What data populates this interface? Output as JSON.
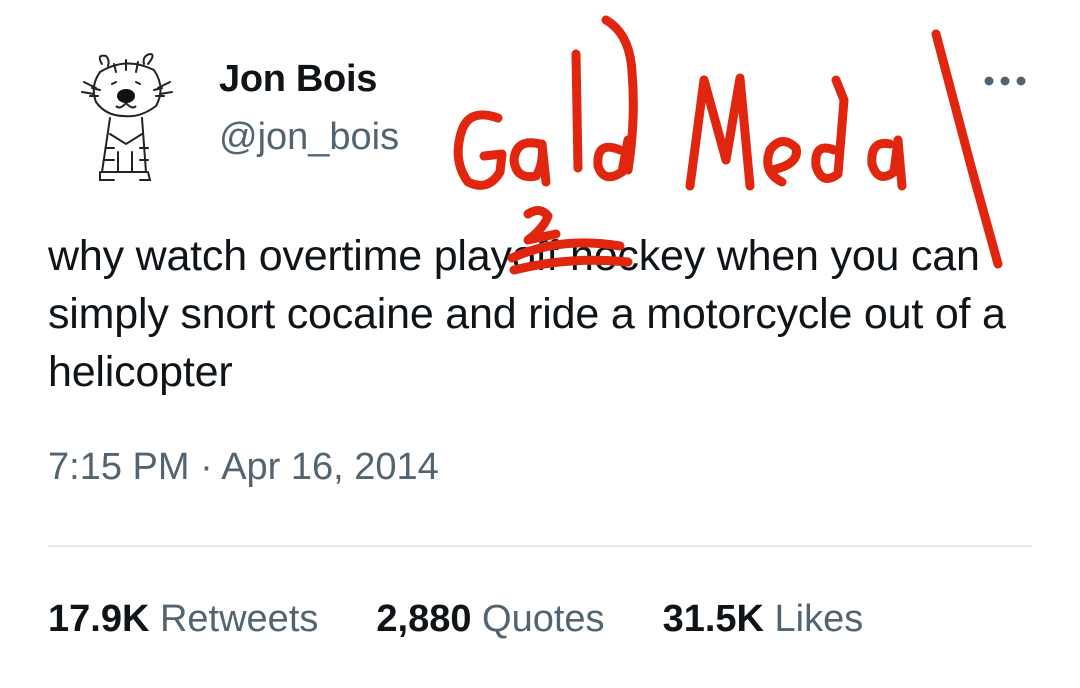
{
  "tweet": {
    "author": {
      "display_name": "Jon Bois",
      "handle": "@jon_bois",
      "avatar_icon": "calvin-and-hobbes-tiger-avatar"
    },
    "more_icon": "more-dots-icon",
    "text": "why watch overtime playoff hockey when you can simply snort cocaine and ride a motorcycle out of a helicopter",
    "timestamp": "7:15 PM · Apr 16, 2014",
    "stats": {
      "retweets": {
        "count": "17.9K",
        "label": "Retweets"
      },
      "quotes": {
        "count": "2,880",
        "label": "Quotes"
      },
      "likes": {
        "count": "31.5K",
        "label": "Likes"
      }
    }
  },
  "annotation": {
    "handwritten_text": "Gold Medal",
    "color": "#e0260f"
  }
}
